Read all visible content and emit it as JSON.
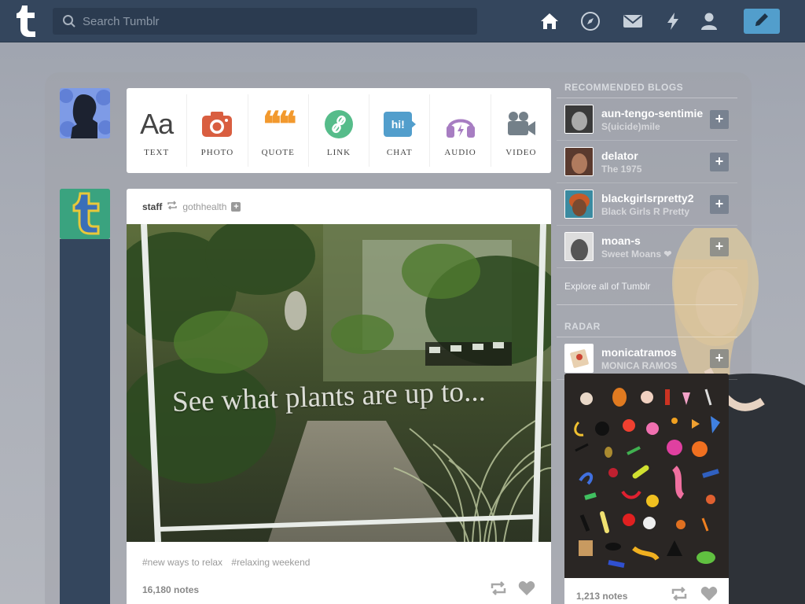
{
  "header": {
    "search_placeholder": "Search Tumblr",
    "nav_icons": [
      "home-icon",
      "explore-icon",
      "inbox-icon",
      "activity-icon",
      "account-icon"
    ],
    "compose_icon": "pencil-icon",
    "colors": {
      "bar": "#34465d",
      "search": "#2b3b50",
      "compose": "#529ecc"
    }
  },
  "post_form": {
    "items": [
      {
        "label": "TEXT",
        "icon": "text-icon"
      },
      {
        "label": "PHOTO",
        "icon": "camera-icon"
      },
      {
        "label": "QUOTE",
        "icon": "quote-icon"
      },
      {
        "label": "LINK",
        "icon": "link-icon"
      },
      {
        "label": "CHAT",
        "icon": "chat-icon"
      },
      {
        "label": "AUDIO",
        "icon": "headphones-icon"
      },
      {
        "label": "VIDEO",
        "icon": "video-camera-icon"
      }
    ],
    "text_icon_glyph": "Aa",
    "quote_icon_glyph": "❝❝",
    "chat_icon_glyph": "hi!"
  },
  "post": {
    "blog": "staff",
    "source": "gothhealth",
    "image_caption": "See what plants are up to...",
    "tags": [
      "#new ways to relax",
      "#relaxing weekend"
    ],
    "notes": "16,180 notes"
  },
  "sidebar": {
    "recommended_title": "RECOMMENDED BLOGS",
    "recommended": [
      {
        "name": "aun-tengo-sentimie",
        "sub": "S(uicide)mile"
      },
      {
        "name": "delator",
        "sub": "The 1975"
      },
      {
        "name": "blackgirlsrpretty2",
        "sub": "Black Girls R Pretty"
      },
      {
        "name": "moan-s",
        "sub": "Sweet Moans ❤"
      }
    ],
    "explore": "Explore all of Tumblr",
    "radar_title": "RADAR",
    "radar": {
      "name": "monicatramos",
      "sub": "MONICA RAMOS",
      "notes": "1,213 notes"
    }
  }
}
